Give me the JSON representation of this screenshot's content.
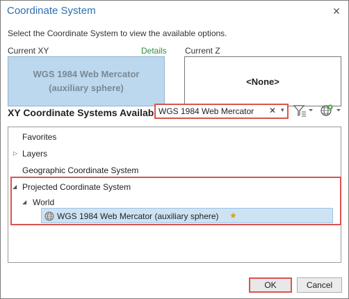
{
  "window": {
    "title": "Coordinate System",
    "close_glyph": "✕"
  },
  "instructions": "Select the Coordinate System to view the available options.",
  "current_xy": {
    "label": "Current XY",
    "details_link": "Details",
    "value_line1": "WGS 1984 Web Mercator",
    "value_line2": "(auxiliary sphere)"
  },
  "current_z": {
    "label": "Current Z",
    "value": "<None>"
  },
  "xy_section": {
    "title": "XY Coordinate Systems Available"
  },
  "search": {
    "value": "WGS 1984 Web Mercator",
    "clear_glyph": "✕",
    "dropdown_glyph": "▾"
  },
  "toolbar": {
    "filter_icon": "filter-icon",
    "add_coordinate_system_icon": "globe-add-icon"
  },
  "tree": {
    "favorites": "Favorites",
    "layers": "Layers",
    "geographic": "Geographic Coordinate System",
    "projected": "Projected Coordinate System",
    "world": "World",
    "selected": "WGS 1984 Web Mercator (auxiliary sphere)",
    "favorite_star": "★"
  },
  "buttons": {
    "ok": "OK",
    "cancel": "Cancel"
  },
  "colors": {
    "title": "#2a6fb0",
    "details": "#2e8b3e",
    "selected_bg": "#cde3f4",
    "highlight": "#d9534f",
    "current_xy_bg": "#bcd8ee"
  }
}
